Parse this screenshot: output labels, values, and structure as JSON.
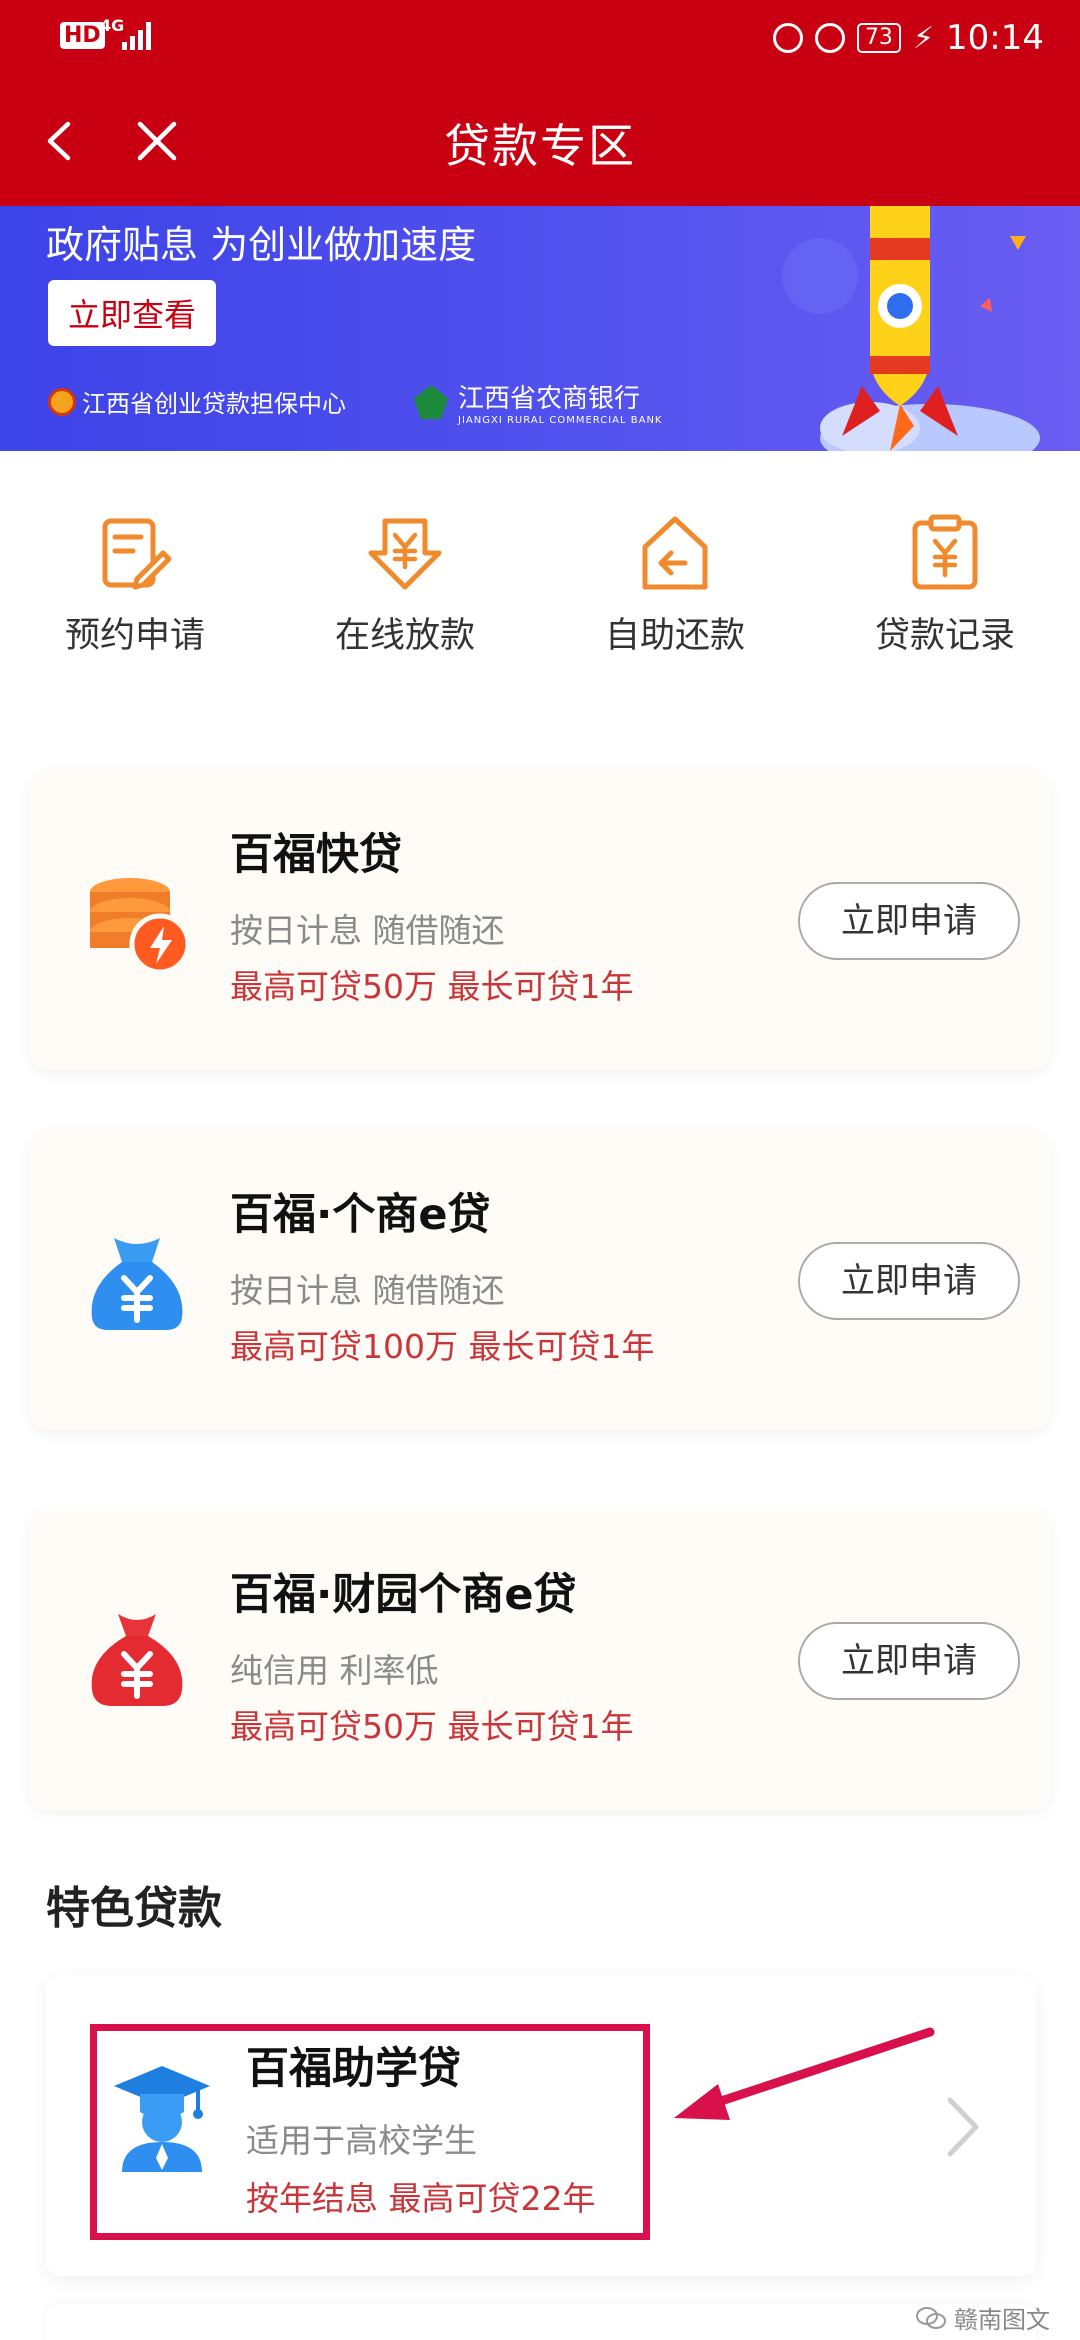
{
  "status_bar": {
    "hd": "HD",
    "network": "4G",
    "battery": "73",
    "time": "10:14"
  },
  "header": {
    "title": "贷款专区"
  },
  "banner": {
    "headline": "政府贴息 为创业做加速度",
    "button": "立即查看",
    "partner1": "江西省创业贷款担保中心",
    "partner2": "江西省农商银行",
    "partner2_en": "JIANGXI RURAL COMMERCIAL BANK"
  },
  "quick_actions": [
    {
      "label": "预约申请",
      "icon": "form-edit-icon"
    },
    {
      "label": "在线放款",
      "icon": "yuan-download-icon"
    },
    {
      "label": "自助还款",
      "icon": "house-return-icon"
    },
    {
      "label": "贷款记录",
      "icon": "clipboard-yuan-icon"
    }
  ],
  "loans": [
    {
      "title": "百福快贷",
      "desc": "按日计息 随借随还",
      "limit": "最高可贷50万 最长可贷1年",
      "button": "立即申请",
      "icon": "coin-stack-bolt-icon"
    },
    {
      "title": "百福·个商e贷",
      "desc": "按日计息 随借随还",
      "limit": "最高可贷100万 最长可贷1年",
      "button": "立即申请",
      "icon": "blue-money-bag-icon"
    },
    {
      "title": "百福·财园个商e贷",
      "desc": "纯信用 利率低",
      "limit": "最高可贷50万 最长可贷1年",
      "button": "立即申请",
      "icon": "red-money-bag-icon"
    }
  ],
  "special": {
    "section_title": "特色贷款",
    "title": "百福助学贷",
    "desc": "适用于高校学生",
    "limit": "按年结息 最高可贷22年",
    "icon": "graduate-icon"
  },
  "watermark": "赣南图文",
  "colors": {
    "brand_red": "#c80011",
    "accent_red": "#c9363a",
    "banner_blue": "#4b4cea",
    "icon_orange": "#f08a2c",
    "highlight": "#d8104b"
  }
}
